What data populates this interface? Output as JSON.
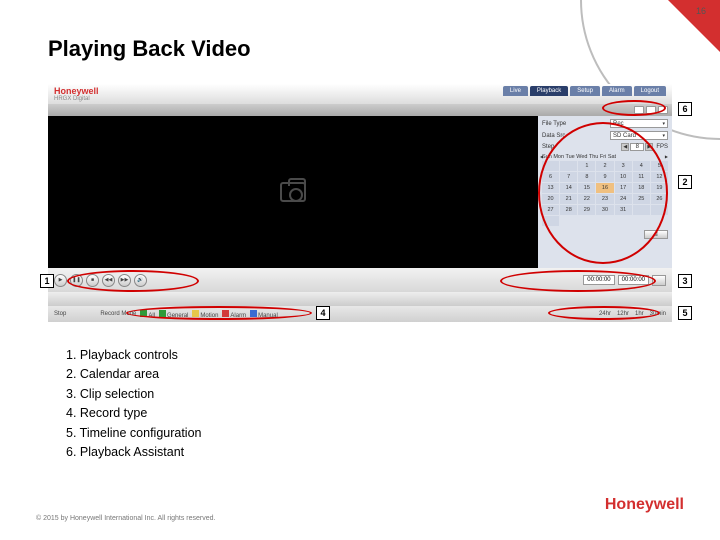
{
  "page_number": "16",
  "title": "Playing Back Video",
  "brand": "Honeywell",
  "subbrand": "HRGX Digital",
  "tabs": [
    "Live",
    "Playback",
    "Setup",
    "Alarm",
    "Logout"
  ],
  "active_tab": 1,
  "sidepanel": {
    "file_type_label": "File Type",
    "file_type_value": "Rec",
    "data_src_label": "Data Src",
    "data_src_value": "SD Card",
    "step_label": "Step",
    "step_value": "8",
    "step_unit": "FPS",
    "cal_header": "Sun Mon Tue Wed Thu   Fri   Sat",
    "cal_days": [
      "",
      "",
      "1",
      "2",
      "3",
      "4",
      "5",
      "6",
      "7",
      "8",
      "9",
      "10",
      "11",
      "12",
      "13",
      "14",
      "15",
      "16",
      "17",
      "18",
      "19",
      "20",
      "21",
      "22",
      "23",
      "24",
      "25",
      "26",
      "27",
      "28",
      "29",
      "30",
      "31",
      "",
      "",
      ""
    ],
    "hi_index": 17,
    "cal_btn_icon": "≡"
  },
  "playback_glyphs": [
    "▶",
    "❚❚",
    "■",
    "◀◀",
    "▶▶",
    "🔊"
  ],
  "clip": {
    "start": "00:00:00",
    "end": "00:00:00"
  },
  "footer": {
    "stop": "Stop",
    "rec_mode": "Record Mode",
    "types": [
      {
        "color": "#2e9b3a",
        "label": "All"
      },
      {
        "color": "#2e9b3a",
        "label": "General"
      },
      {
        "color": "#e6c84a",
        "label": "Motion"
      },
      {
        "color": "#d23b3b",
        "label": "Alarm"
      },
      {
        "color": "#3a6bd2",
        "label": "Manual"
      }
    ],
    "right": [
      "24hr",
      "12hr",
      "1hr",
      "30min"
    ]
  },
  "callouts": {
    "c1": "1",
    "c2": "2",
    "c3": "3",
    "c4": "4",
    "c5": "5",
    "c6": "6"
  },
  "legend": [
    "1. Playback controls",
    "2. Calendar area",
    "3. Clip selection",
    "4. Record type",
    "5. Timeline configuration",
    "6. Playback Assistant"
  ],
  "copyright": "© 2015 by Honeywell International Inc. All rights reserved.",
  "logo": "Honeywell"
}
